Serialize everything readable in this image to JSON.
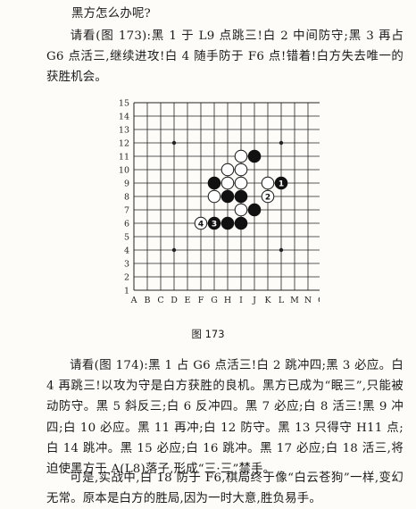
{
  "text": {
    "heading": "黑方怎么办呢?",
    "para1": "请看(图 173):黑 1 于 L9 点跳三!白 2 中间防守;黑 3 再占 G6 点活三,继续进攻!白 4 随手防于 F6 点!错着!白方失去唯一的获胜机会。",
    "caption": "图 173",
    "para2": "请看(图 174):黑 1 占 G6 点活三!白 2 跳冲四;黑 3 必应。白 4 再跳三!以攻为守是白方获胜的良机。黑方已成为“眠三”,只能被动防守。黑 5 斜反三;白 6 反冲四。黑 7 必应;白 8 活三!黑 9 冲四;白 10 必应。黑 11 再冲;白 12 防守。黑 13 只得守 H11 点;白 14 跳冲。黑 15 必应;白 16 跳冲。黑 17 必应;白 18 活三,将迫使黑方于 A(L8)落子,形成“三·三”禁手。",
    "para3": "可是,实战中,白 18 防于 F6,棋局终于像“白云苍狗”一样,变幻无常。原本是白方的胜局,因为一时大意,胜负易手。"
  },
  "board": {
    "size": 15,
    "col_labels": [
      "A",
      "B",
      "C",
      "D",
      "E",
      "F",
      "G",
      "H",
      "I",
      "J",
      "K",
      "L",
      "M",
      "N",
      "O"
    ],
    "row_labels": [
      "15",
      "14",
      "13",
      "12",
      "11",
      "10",
      "9",
      "8",
      "7",
      "6",
      "5",
      "4",
      "3",
      "2",
      "1"
    ],
    "star_points": [
      "D12",
      "L12",
      "D4",
      "L4"
    ],
    "stones": [
      {
        "pos": "I11",
        "color": "white",
        "label": ""
      },
      {
        "pos": "J11",
        "color": "black",
        "label": ""
      },
      {
        "pos": "H10",
        "color": "white",
        "label": ""
      },
      {
        "pos": "I10",
        "color": "white",
        "label": ""
      },
      {
        "pos": "G9",
        "color": "black",
        "label": ""
      },
      {
        "pos": "H9",
        "color": "white",
        "label": ""
      },
      {
        "pos": "I9",
        "color": "white",
        "label": ""
      },
      {
        "pos": "K9",
        "color": "white",
        "label": ""
      },
      {
        "pos": "L9",
        "color": "black",
        "label": "1"
      },
      {
        "pos": "G8",
        "color": "white",
        "label": ""
      },
      {
        "pos": "H8",
        "color": "black",
        "label": ""
      },
      {
        "pos": "I8",
        "color": "black",
        "label": ""
      },
      {
        "pos": "K8",
        "color": "white",
        "label": "2"
      },
      {
        "pos": "I7",
        "color": "white",
        "label": ""
      },
      {
        "pos": "J7",
        "color": "black",
        "label": ""
      },
      {
        "pos": "F6",
        "color": "white",
        "label": "4"
      },
      {
        "pos": "G6",
        "color": "black",
        "label": "3"
      },
      {
        "pos": "H6",
        "color": "black",
        "label": ""
      },
      {
        "pos": "I6",
        "color": "black",
        "label": ""
      }
    ],
    "colors": {
      "line": "#222222",
      "black_stone": "#111111",
      "white_stone": "#ffffff"
    }
  }
}
